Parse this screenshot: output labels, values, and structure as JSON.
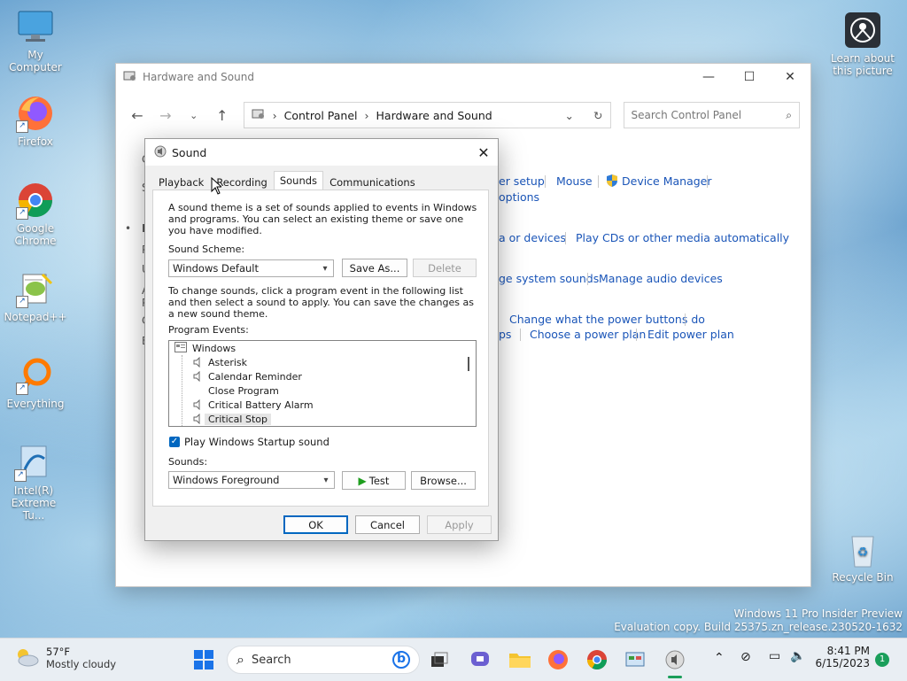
{
  "desktop": {
    "icons": [
      {
        "label": "My Computer"
      },
      {
        "label": "Firefox"
      },
      {
        "label": "Google Chrome"
      },
      {
        "label": "Notepad++"
      },
      {
        "label": "Everything"
      },
      {
        "label": "Intel(R) Extreme Tu..."
      }
    ],
    "learn_label": "Learn about this picture",
    "recycle_label": "Recycle Bin",
    "watermark_line1": "Windows 11 Pro Insider Preview",
    "watermark_line2": "Evaluation copy. Build 25375.zn_release.230520-1632"
  },
  "explorer": {
    "title": "Hardware and Sound",
    "breadcrumb": [
      "Control Panel",
      "Hardware and Sound"
    ],
    "search_placeholder": "Search Control Panel",
    "links": {
      "printer_setup": "er setup",
      "mouse": "Mouse",
      "device_manager": "Device Manager",
      "options": "options",
      "media_devices": "a or devices",
      "play_cds": "Play CDs or other media automatically",
      "system_sounds": "ge system sounds",
      "manage_audio": "Manage audio devices",
      "power_buttons": "Change what the power buttons do",
      "ps": "ps",
      "power_plan": "Choose a power plan",
      "edit_power_plan": "Edit power plan"
    }
  },
  "sound": {
    "title": "Sound",
    "tabs": [
      "Playback",
      "Recording",
      "Sounds",
      "Communications"
    ],
    "description": "A sound theme is a set of sounds applied to events in Windows and programs. You can select an existing theme or save one you have modified.",
    "scheme_label": "Sound Scheme:",
    "scheme_value": "Windows Default",
    "save_as": "Save As...",
    "delete": "Delete",
    "instructions": "To change sounds, click a program event in the following list and then select a sound to apply. You can save the changes as a new sound theme.",
    "events_label": "Program Events:",
    "events_root": "Windows",
    "events": [
      "Asterisk",
      "Calendar Reminder",
      "Close Program",
      "Critical Battery Alarm",
      "Critical Stop"
    ],
    "startup_label": "Play Windows Startup sound",
    "sounds_label": "Sounds:",
    "sound_value": "Windows Foreground",
    "test": "Test",
    "browse": "Browse...",
    "ok": "OK",
    "cancel": "Cancel",
    "apply": "Apply"
  },
  "taskbar": {
    "weather_temp": "57°F",
    "weather_desc": "Mostly cloudy",
    "search": "Search",
    "time": "8:41 PM",
    "date": "6/15/2023",
    "notif_count": "1"
  }
}
